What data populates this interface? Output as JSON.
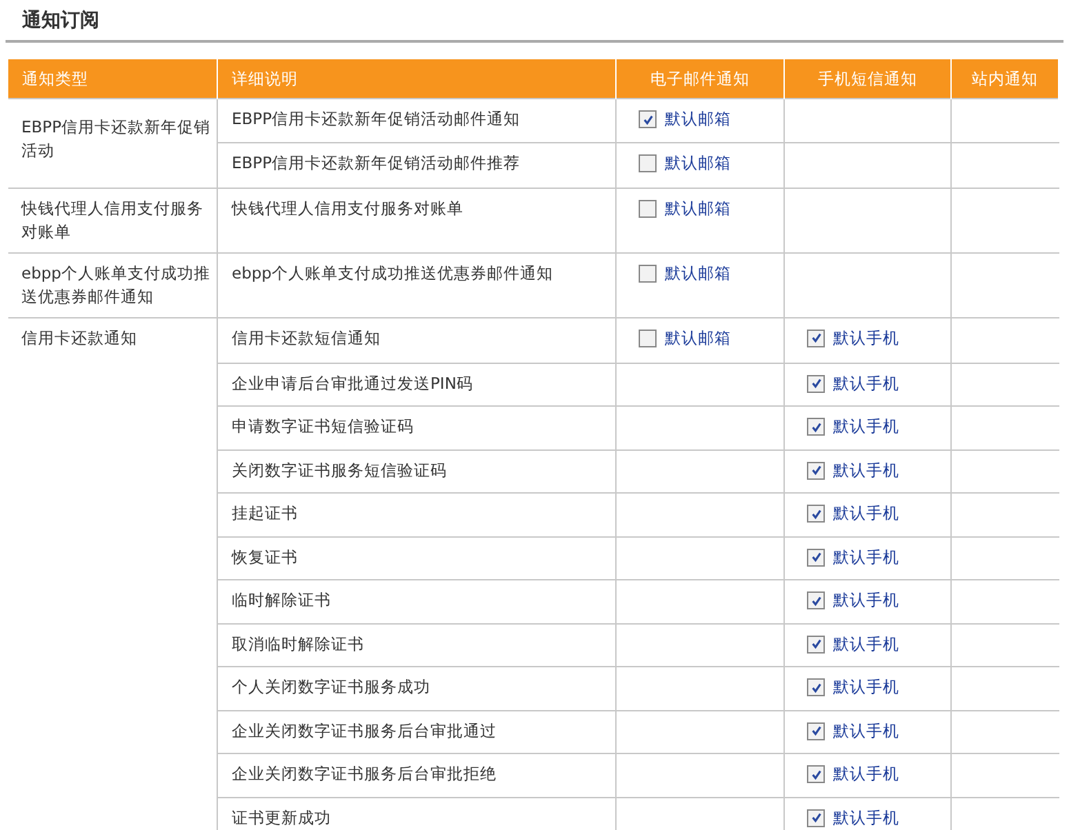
{
  "title": "通知订阅",
  "columns": [
    "通知类型",
    "详细说明",
    "电子邮件通知",
    "手机短信通知",
    "站内通知"
  ],
  "groups": [
    {
      "type": "EBPP信用卡还款新年促销活动",
      "items": [
        {
          "detail": "EBPP信用卡还款新年促销活动邮件通知",
          "email": {
            "label": "默认邮箱",
            "checked": true
          }
        },
        {
          "detail": "EBPP信用卡还款新年促销活动邮件推荐",
          "email": {
            "label": "默认邮箱",
            "checked": false
          }
        }
      ]
    },
    {
      "type": "快钱代理人信用支付服务对账单",
      "items": [
        {
          "detail": "快钱代理人信用支付服务对账单",
          "email": {
            "label": "默认邮箱",
            "checked": false
          }
        }
      ]
    },
    {
      "type": "ebpp个人账单支付成功推送优惠券邮件通知",
      "items": [
        {
          "detail": "ebpp个人账单支付成功推送优惠券邮件通知",
          "email": {
            "label": "默认邮箱",
            "checked": false
          }
        }
      ]
    },
    {
      "type": "信用卡还款通知",
      "items": [
        {
          "detail": "信用卡还款短信通知",
          "email": {
            "label": "默认邮箱",
            "checked": false
          },
          "sms": {
            "label": "默认手机",
            "checked": true
          }
        },
        {
          "detail": "企业申请后台审批通过发送PIN码",
          "sms": {
            "label": "默认手机",
            "checked": true
          }
        },
        {
          "detail": "申请数字证书短信验证码",
          "sms": {
            "label": "默认手机",
            "checked": true
          }
        },
        {
          "detail": "关闭数字证书服务短信验证码",
          "sms": {
            "label": "默认手机",
            "checked": true
          }
        },
        {
          "detail": "挂起证书",
          "sms": {
            "label": "默认手机",
            "checked": true
          }
        },
        {
          "detail": "恢复证书",
          "sms": {
            "label": "默认手机",
            "checked": true
          }
        },
        {
          "detail": "临时解除证书",
          "sms": {
            "label": "默认手机",
            "checked": true
          }
        },
        {
          "detail": "取消临时解除证书",
          "sms": {
            "label": "默认手机",
            "checked": true
          }
        },
        {
          "detail": "个人关闭数字证书服务成功",
          "sms": {
            "label": "默认手机",
            "checked": true
          }
        },
        {
          "detail": "企业关闭数字证书服务后台审批通过",
          "sms": {
            "label": "默认手机",
            "checked": true
          }
        },
        {
          "detail": "企业关闭数字证书服务后台审批拒绝",
          "sms": {
            "label": "默认手机",
            "checked": true
          }
        },
        {
          "detail": "证书更新成功",
          "sms": {
            "label": "默认手机",
            "checked": true
          }
        }
      ]
    }
  ]
}
